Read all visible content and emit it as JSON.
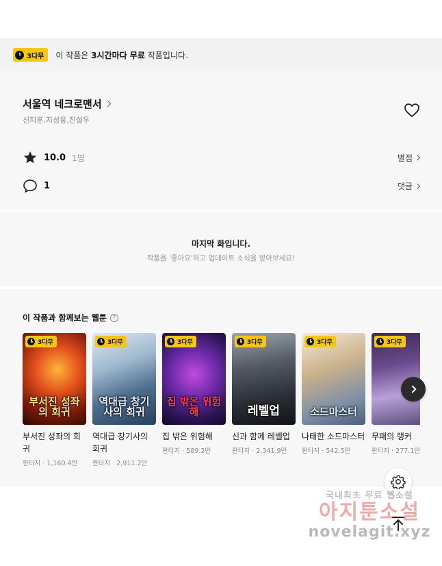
{
  "notice": {
    "badge": "3다무",
    "prefix": "이 작품은 ",
    "emphasis": "3시간마다 무료",
    "suffix": " 작품입니다."
  },
  "work": {
    "title": "서울역 네크로맨서",
    "authors": "신지훈,지성웅,진설우",
    "rating": "10.0",
    "rating_count": "1명",
    "rate_link": "별점",
    "comment_count": "1",
    "comment_link": "댓글"
  },
  "last_episode": {
    "title": "마지막 화입니다.",
    "subtitle": "작품을 '좋아요'하고 업데이트 소식을 받아보세요!"
  },
  "recommendations": {
    "heading": "이 작품과 함께보는 웹툰",
    "help_icon": "?",
    "items": [
      {
        "badge": "3다무",
        "title": "부서진 성좌의 회귀",
        "genre": "판타지",
        "views": "1,160.4만",
        "cover_text": "부서진 성좌의 회귀"
      },
      {
        "badge": "3다무",
        "title": "역대급 창기사의 회귀",
        "genre": "판타지",
        "views": "2,911.2만",
        "cover_text": "역대급 창기사의 회귀"
      },
      {
        "badge": "3다무",
        "title": "집 밖은 위험해",
        "genre": "판타지",
        "views": "589.2만",
        "cover_text": "집 밖은 위험해"
      },
      {
        "badge": "3다무",
        "title": "신과 함께 레벨업",
        "genre": "판타지",
        "views": "2,341.9만",
        "cover_text": "레벨업"
      },
      {
        "badge": "3다무",
        "title": "나태한 소드마스터",
        "genre": "판타지",
        "views": "542.5만",
        "cover_text": "소드마스터"
      },
      {
        "badge": "3다무",
        "title": "무패의 랭커",
        "genre": "판타지",
        "views": "277.1만",
        "cover_text": ""
      }
    ]
  },
  "watermark": {
    "line1": "국내최초 무료 웹소설",
    "line2": "아지툰소설",
    "line3": "novelagit.xyz"
  },
  "colors": {
    "badge": "#f5c518",
    "panel": "#f7f7f7",
    "notice_bg": "#f2f2f2"
  }
}
